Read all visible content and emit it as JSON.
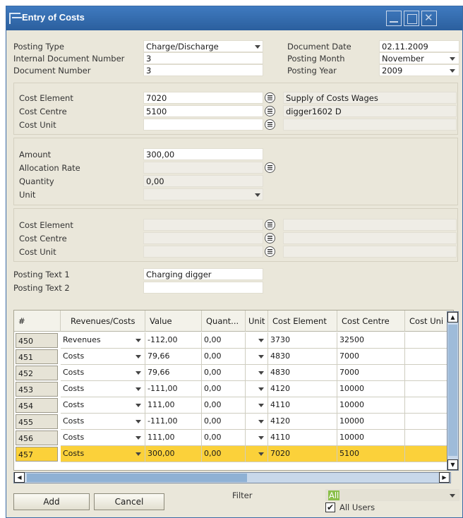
{
  "window": {
    "title": "Entry of Costs"
  },
  "header": {
    "posting_type": {
      "label": "Posting Type",
      "value": "Charge/Discharge"
    },
    "internal_doc": {
      "label": "Internal Document Number",
      "value": "3"
    },
    "doc_number": {
      "label": "Document Number",
      "value": "3"
    },
    "doc_date": {
      "label": "Document Date",
      "value": "02.11.2009"
    },
    "posting_month": {
      "label": "Posting Month",
      "value": "November"
    },
    "posting_year": {
      "label": "Posting Year",
      "value": "2009"
    }
  },
  "sender": {
    "cost_element": {
      "label": "Cost Element",
      "value": "7020",
      "desc": "Supply of Costs Wages"
    },
    "cost_centre": {
      "label": "Cost Centre",
      "value": "5100",
      "desc": "digger1602 D"
    },
    "cost_unit": {
      "label": "Cost Unit",
      "value": "",
      "desc": ""
    }
  },
  "amounts": {
    "amount": {
      "label": "Amount",
      "value": "300,00"
    },
    "allocation_rate": {
      "label": "Allocation Rate",
      "value": ""
    },
    "quantity": {
      "label": "Quantity",
      "value": "0,00"
    },
    "unit": {
      "label": "Unit",
      "value": ""
    }
  },
  "receiver": {
    "cost_element": {
      "label": "Cost Element"
    },
    "cost_centre": {
      "label": "Cost Centre"
    },
    "cost_unit": {
      "label": "Cost Unit"
    }
  },
  "texts": {
    "posting_text_1": {
      "label": "Posting Text 1",
      "value": "Charging digger"
    },
    "posting_text_2": {
      "label": "Posting Text 2",
      "value": ""
    }
  },
  "grid": {
    "columns": [
      "#",
      "Revenues/Costs",
      "Value",
      "Quant...",
      "Unit",
      "Cost Element",
      "Cost Centre",
      "Cost Uni"
    ],
    "rows": [
      {
        "n": "450",
        "type": "Revenues",
        "value": "-112,00",
        "qty": "0,00",
        "unit": "",
        "ce": "3730",
        "cc": "32500",
        "cu": ""
      },
      {
        "n": "451",
        "type": "Costs",
        "value": "79,66",
        "qty": "0,00",
        "unit": "",
        "ce": "4830",
        "cc": "7000",
        "cu": ""
      },
      {
        "n": "452",
        "type": "Costs",
        "value": "79,66",
        "qty": "0,00",
        "unit": "",
        "ce": "4830",
        "cc": "7000",
        "cu": ""
      },
      {
        "n": "453",
        "type": "Costs",
        "value": "-111,00",
        "qty": "0,00",
        "unit": "",
        "ce": "4120",
        "cc": "10000",
        "cu": ""
      },
      {
        "n": "454",
        "type": "Costs",
        "value": "111,00",
        "qty": "0,00",
        "unit": "",
        "ce": "4110",
        "cc": "10000",
        "cu": ""
      },
      {
        "n": "455",
        "type": "Costs",
        "value": "-111,00",
        "qty": "0,00",
        "unit": "",
        "ce": "4120",
        "cc": "10000",
        "cu": ""
      },
      {
        "n": "456",
        "type": "Costs",
        "value": "111,00",
        "qty": "0,00",
        "unit": "",
        "ce": "4110",
        "cc": "10000",
        "cu": ""
      },
      {
        "n": "457",
        "type": "Costs",
        "value": "300,00",
        "qty": "0,00",
        "unit": "",
        "ce": "7020",
        "cc": "5100",
        "cu": ""
      }
    ],
    "selected_row": "457"
  },
  "footer": {
    "add_label": "Add",
    "cancel_label": "Cancel",
    "filter_label": "Filter",
    "filter_value": "All",
    "all_users_label": "All Users",
    "all_users_checked": true
  },
  "colors": {
    "title_bar": "#2f69ad",
    "selected_row": "#fbd13a",
    "window_bg": "#eae7da"
  }
}
